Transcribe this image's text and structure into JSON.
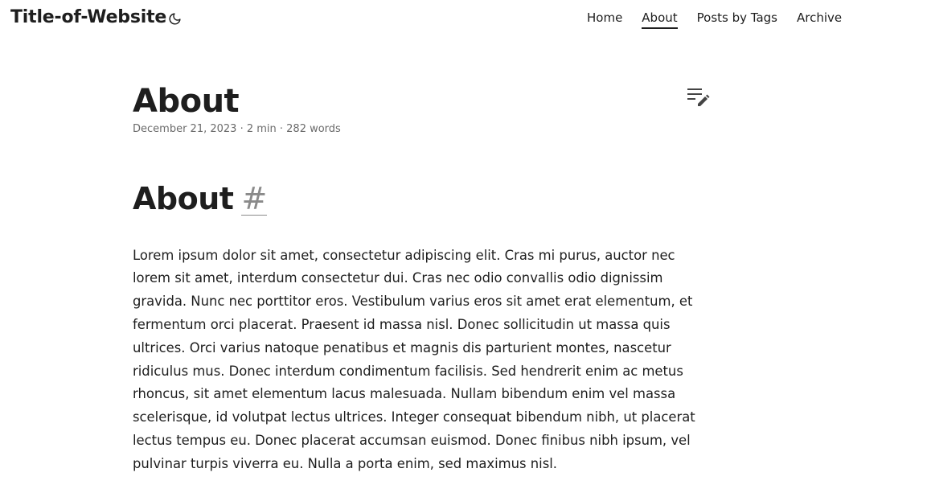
{
  "header": {
    "site_title": "Title-of-Website",
    "theme_toggle_icon": "moon-icon",
    "nav": [
      {
        "label": "Home",
        "active": false
      },
      {
        "label": "About",
        "active": true
      },
      {
        "label": "Posts by Tags",
        "active": false
      },
      {
        "label": "Archive",
        "active": false
      }
    ]
  },
  "post": {
    "title": "About",
    "meta": "December 21, 2023 · 2 min · 282 words",
    "edit_icon": "edit-post-icon",
    "heading": "About",
    "heading_anchor": "#",
    "body": "Lorem ipsum dolor sit amet, consectetur adipiscing elit. Cras mi purus, auctor nec lorem sit amet, interdum consectetur dui. Cras nec odio convallis odio dignissim gravida. Nunc nec porttitor eros. Vestibulum varius eros sit amet erat elementum, et fermentum orci placerat. Praesent id massa nisl. Donec sollicitudin ut massa quis ultrices. Orci varius natoque penatibus et magnis dis parturient montes, nascetur ridiculus mus. Donec interdum condimentum facilisis. Sed hendrerit enim ac metus rhoncus, sit amet elementum lacus malesuada. Nullam bibendum enim vel massa scelerisque, id volutpat lectus ultrices. Integer consequat bibendum nibh, ut placerat lectus tempus eu. Donec placerat accumsan euismod. Donec finibus nibh ipsum, vel pulvinar turpis viverra eu. Nulla a porta enim, sed maximus nisl."
  }
}
